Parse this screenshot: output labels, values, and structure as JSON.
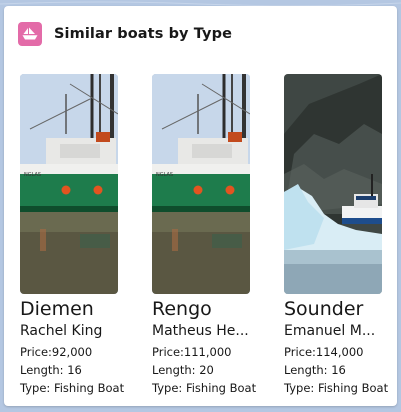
{
  "header": {
    "title": "Similar boats by Type",
    "icon": "boat-icon",
    "icon_color": "#e36ba8"
  },
  "boats": [
    {
      "name": "Diemen",
      "owner": "Rachel King",
      "price": "Price:92,000",
      "length": "Length: 16",
      "type": "Type: Fishing Boat",
      "image": "fishing-trawler-photo"
    },
    {
      "name": "Rengo",
      "owner": "Matheus He...",
      "price": "Price:111,000",
      "length": "Length: 20",
      "type": "Type: Fishing Boat",
      "image": "fishing-trawler-photo"
    },
    {
      "name": "Sounder",
      "owner": "Emanuel M...",
      "price": "Price:114,000",
      "length": "Length: 16",
      "type": "Type: Fishing Boat",
      "image": "boat-near-iceberg-photo"
    }
  ],
  "colors": {
    "background": "#b4c7e2",
    "card": "#ffffff",
    "text": "#181818"
  }
}
